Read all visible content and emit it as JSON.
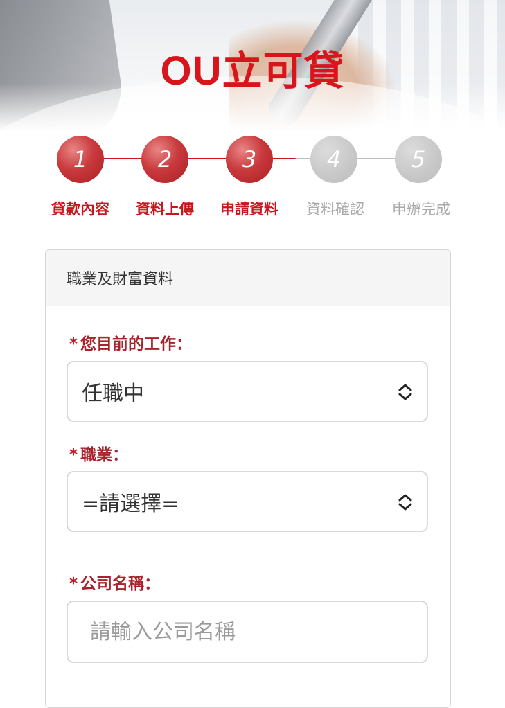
{
  "banner": {
    "title": "OU立可貸"
  },
  "steps": [
    {
      "number": "1",
      "label": "貸款內容",
      "status": "done"
    },
    {
      "number": "2",
      "label": "資料上傳",
      "status": "done"
    },
    {
      "number": "3",
      "label": "申請資料",
      "status": "done"
    },
    {
      "number": "4",
      "label": "資料確認",
      "status": "todo"
    },
    {
      "number": "5",
      "label": "申辦完成",
      "status": "todo"
    }
  ],
  "colors": {
    "accent": "#c8161d",
    "label": "#a8232b",
    "inactive": "#bdbdbd"
  },
  "form": {
    "section_title": "職業及財富資料",
    "required_mark": "*",
    "job_status": {
      "label": "您目前的工作：",
      "value": "任職中"
    },
    "occupation": {
      "label": "職業：",
      "value": "=請選擇="
    },
    "company": {
      "label": "公司名稱：",
      "placeholder": "請輸入公司名稱"
    }
  }
}
